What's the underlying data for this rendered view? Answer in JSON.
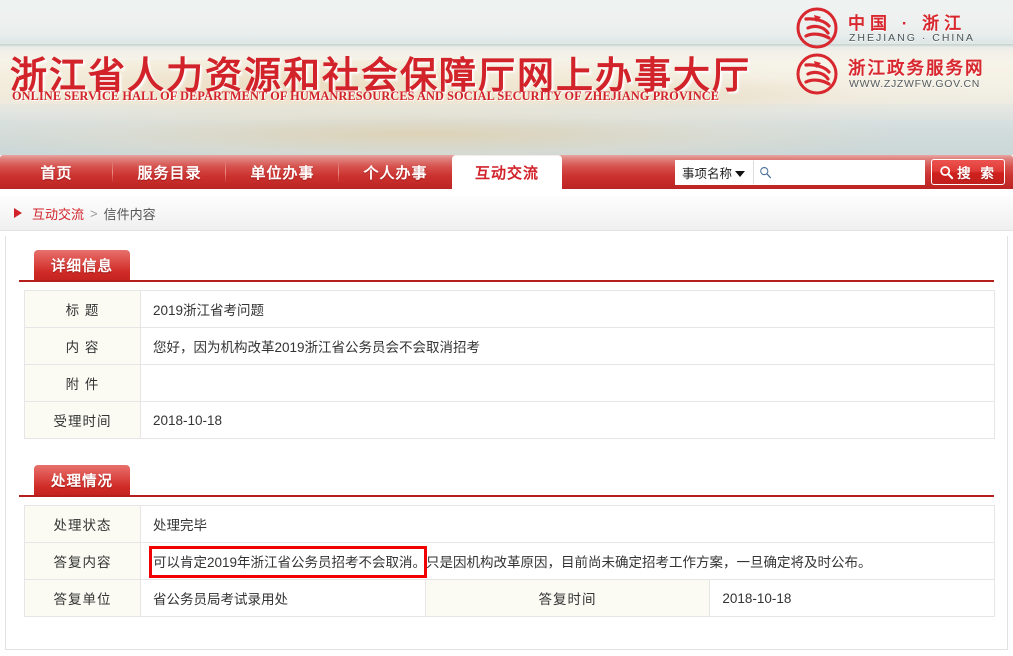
{
  "banner": {
    "title": "浙江省人力资源和社会保障厅网上办事大厅",
    "subtitle": "ONLINE SERVICE HALL OF DEPARTMENT OF HUMANRESOURCES AND SOCIAL SECURITY OF ZHEJIANG PROVINCE",
    "logo_top": {
      "cn": "中国 · 浙江",
      "en": "ZHEJIANG · CHINA"
    },
    "logo_bottom": {
      "cn": "浙江政务服务网",
      "en": "WWW.ZJZWFW.GOV.CN"
    }
  },
  "nav": {
    "items": [
      {
        "label": "首页",
        "active": false
      },
      {
        "label": "服务目录",
        "active": false
      },
      {
        "label": "单位办事",
        "active": false
      },
      {
        "label": "个人办事",
        "active": false
      },
      {
        "label": "互动交流",
        "active": true
      }
    ]
  },
  "search": {
    "selected_option": "事项名称",
    "options": [
      "事项名称"
    ],
    "input_value": "",
    "placeholder": "",
    "button_label": "搜 索"
  },
  "breadcrumb": {
    "link": "互动交流",
    "separator": ">",
    "current": "信件内容"
  },
  "sections": [
    {
      "title": "详细信息",
      "rows": [
        {
          "label": "标  题",
          "value": "2019浙江省考问题"
        },
        {
          "label": "内  容",
          "value": "您好，因为机构改革2019浙江省公务员会不会取消招考"
        },
        {
          "label": "附  件",
          "value": ""
        },
        {
          "label": "受理时间",
          "value": "2018-10-18"
        }
      ]
    },
    {
      "title": "处理情况",
      "rows": [
        {
          "label": "处理状态",
          "value": "处理完毕"
        },
        {
          "label": "答复内容",
          "value": "可以肯定2019年浙江省公务员招考不会取消。只是因机构改革原因，目前尚未确定招考工作方案，一旦确定将及时公布。"
        },
        {
          "label": "答复单位",
          "value": "省公务员局考试录用处",
          "label2": "答复时间",
          "value2": "2018-10-18"
        }
      ]
    }
  ],
  "annotation": {
    "highlight_text": "可以肯定2019年浙江省公务员招考不会取消。",
    "color": "#f10000"
  },
  "colors": {
    "brand_red": "#d2232a",
    "nav_red": "#cb322f",
    "label_bg": "#fbfbf4",
    "border": "#e6e6e6"
  }
}
